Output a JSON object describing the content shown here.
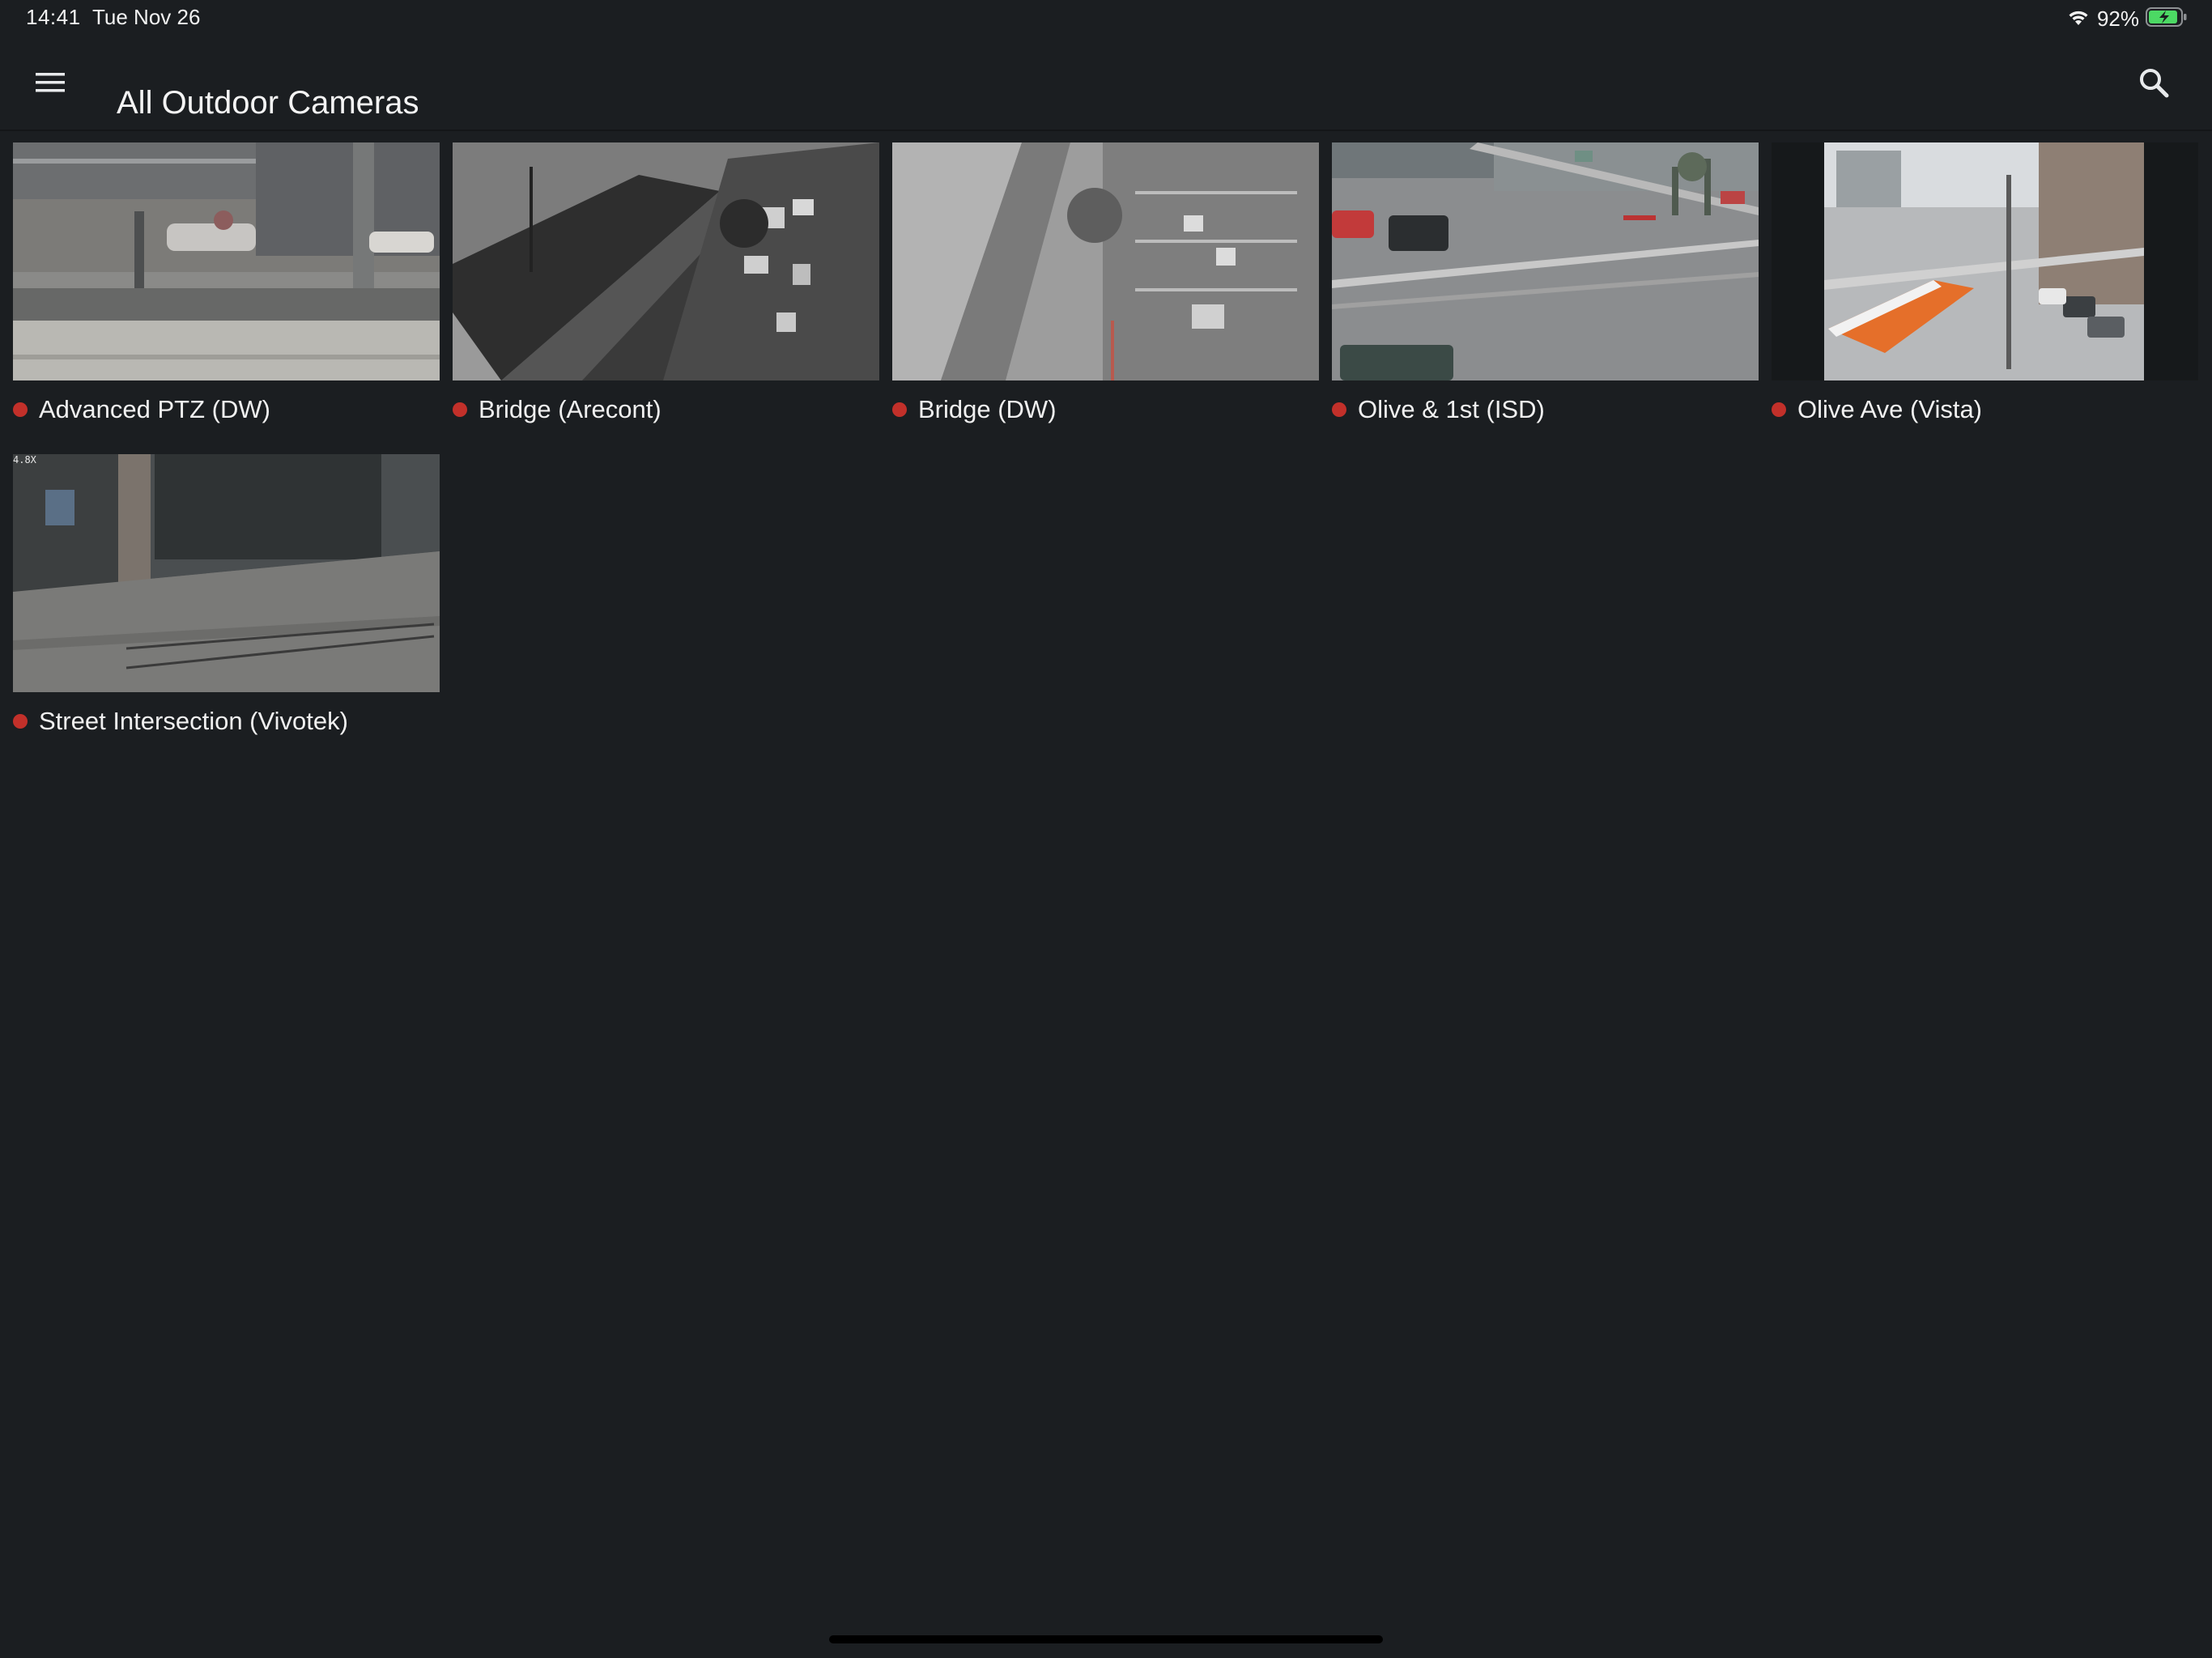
{
  "status_bar": {
    "time": "14:41",
    "date": "Tue Nov 26",
    "battery_percent": "92%",
    "battery_level": 0.92,
    "wifi_icon": "wifi-icon",
    "battery_icon": "battery-charging-icon"
  },
  "header": {
    "title": "All Outdoor Cameras",
    "menu_icon": "hamburger-menu-icon",
    "search_icon": "search-icon"
  },
  "colors": {
    "background": "#1b1e21",
    "status_dot": "#c2302a",
    "battery_fill": "#4cd964"
  },
  "cameras": [
    {
      "name": "Advanced PTZ (DW)",
      "status": "recording",
      "feed_style": "ptz"
    },
    {
      "name": "Bridge (Arecont)",
      "status": "recording",
      "feed_style": "bridge-bw"
    },
    {
      "name": "Bridge (DW)",
      "status": "recording",
      "feed_style": "bridge-gray"
    },
    {
      "name": "Olive & 1st (ISD)",
      "status": "recording",
      "feed_style": "street"
    },
    {
      "name": "Olive Ave (Vista)",
      "status": "recording",
      "feed_style": "vista"
    },
    {
      "name": "Street Intersection (Vivotek)",
      "status": "recording",
      "feed_style": "vivotek",
      "overlay_text": "4.8X"
    }
  ]
}
